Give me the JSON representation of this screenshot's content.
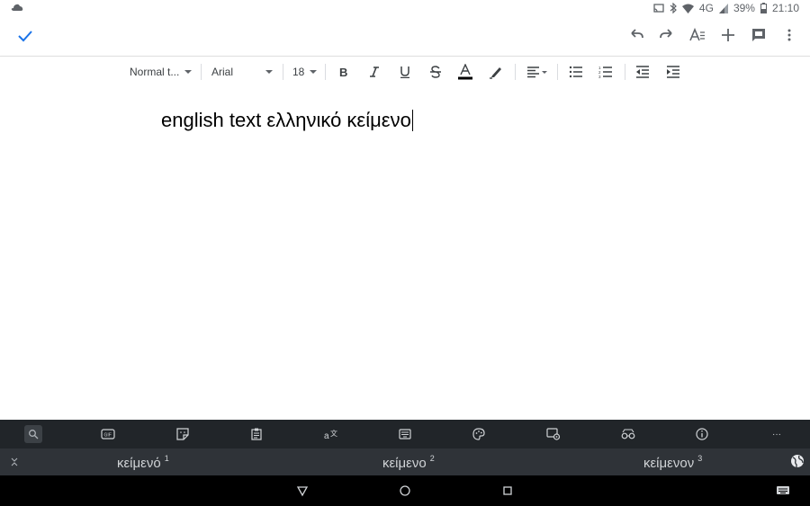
{
  "status": {
    "network_label": "4G",
    "battery": "39%",
    "time": "21:10"
  },
  "toolbar": {
    "style_label": "Normal t...",
    "font_label": "Arial",
    "size_label": "18",
    "text_color": "#000000"
  },
  "document": {
    "text": "english text ελληνικό κείμενο"
  },
  "keyboard": {
    "more_label": "···",
    "suggestions": [
      {
        "word": "κείμενό",
        "index": "1"
      },
      {
        "word": "κείμενο",
        "index": "2"
      },
      {
        "word": "κείμενον",
        "index": "3"
      }
    ]
  },
  "colors": {
    "accent": "#1a73e8",
    "kb_toolbar_bg": "#212529",
    "suggest_bg": "#2f3338"
  }
}
